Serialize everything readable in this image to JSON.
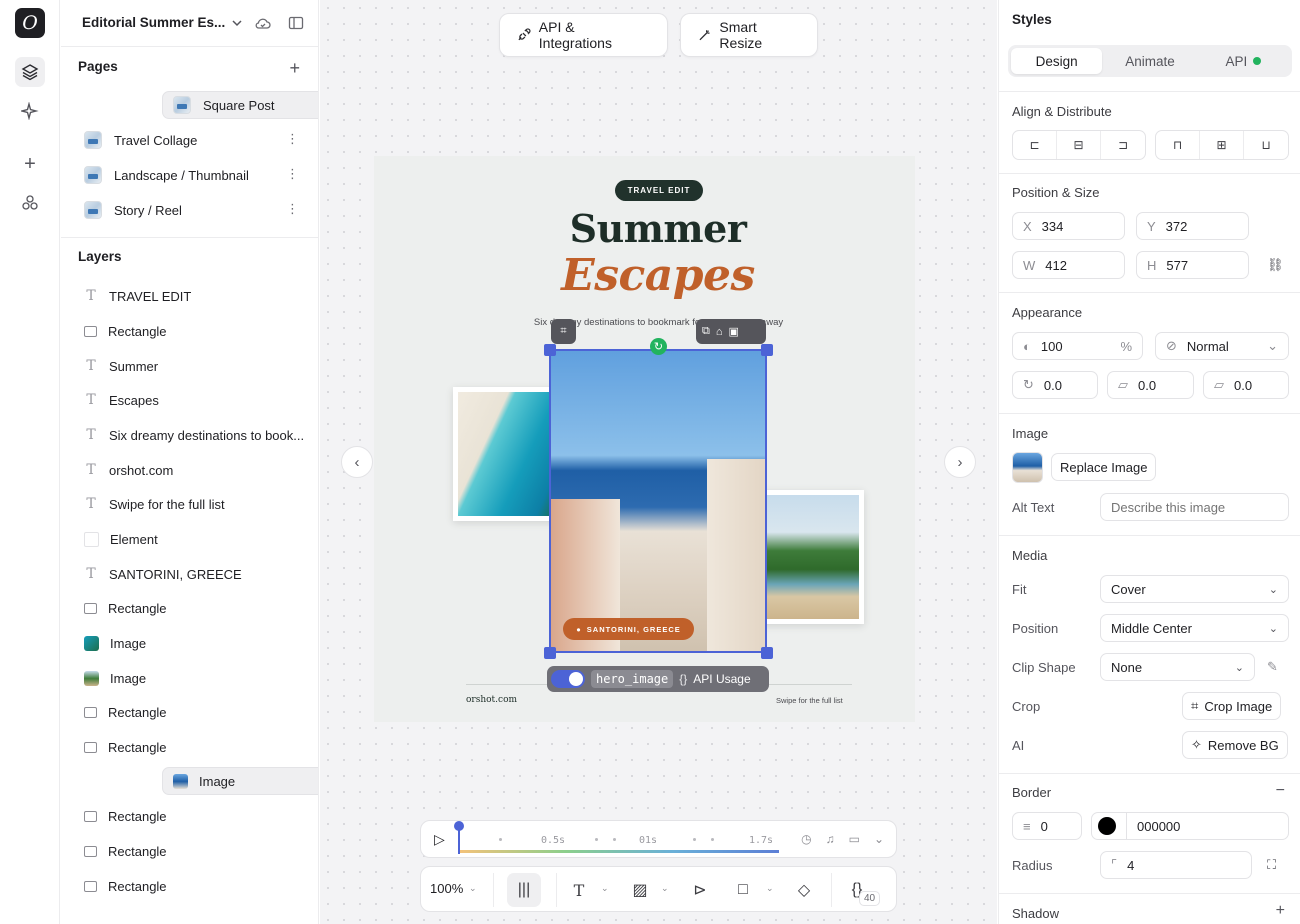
{
  "project": {
    "name": "Editorial Summer Es...",
    "sections": {
      "pages": "Pages",
      "layers": "Layers"
    }
  },
  "pages": [
    {
      "label": "Square Post",
      "selected": true
    },
    {
      "label": "Travel Collage",
      "selected": false
    },
    {
      "label": "Landscape / Thumbnail",
      "selected": false
    },
    {
      "label": "Story / Reel",
      "selected": false
    }
  ],
  "layers": [
    {
      "label": "TRAVEL EDIT",
      "type": "text"
    },
    {
      "label": "Rectangle",
      "type": "rect"
    },
    {
      "label": "Summer",
      "type": "text"
    },
    {
      "label": "Escapes",
      "type": "text"
    },
    {
      "label": "Six dreamy destinations to book...",
      "type": "text"
    },
    {
      "label": "orshot.com",
      "type": "text"
    },
    {
      "label": "Swipe for the full list",
      "type": "text"
    },
    {
      "label": "Element",
      "type": "element"
    },
    {
      "label": "SANTORINI, GREECE",
      "type": "text"
    },
    {
      "label": "Rectangle",
      "type": "rect"
    },
    {
      "label": "Image",
      "type": "image"
    },
    {
      "label": "Image",
      "type": "image"
    },
    {
      "label": "Rectangle",
      "type": "rect"
    },
    {
      "label": "Rectangle",
      "type": "rect"
    },
    {
      "label": "Image",
      "type": "image",
      "selected": true
    },
    {
      "label": "Rectangle",
      "type": "rect"
    },
    {
      "label": "Rectangle",
      "type": "rect"
    },
    {
      "label": "Rectangle",
      "type": "rect"
    }
  ],
  "toolbar": {
    "api": "API & Integrations",
    "resize": "Smart Resize"
  },
  "design": {
    "badge": "TRAVEL EDIT",
    "title1": "Summer",
    "title2": "Escapes",
    "subtitle": "Six dreamy destinations to bookmark for your next getaway",
    "location": "SANTORINI, GREECE",
    "footer_left": "orshot.com",
    "footer_right": "Swipe for the full list"
  },
  "selection": {
    "layer_name": "hero_image",
    "api_usage": "API Usage"
  },
  "timeline": {
    "marks": [
      "0.5s",
      "01s",
      "1.7s"
    ]
  },
  "bottom": {
    "zoom": "100%",
    "count": "40"
  },
  "styles": {
    "title": "Styles",
    "tabs": [
      "Design",
      "Animate",
      "API"
    ],
    "align_title": "Align & Distribute",
    "pos_title": "Position & Size",
    "x": "334",
    "y": "372",
    "w": "412",
    "h": "577",
    "appearance_title": "Appearance",
    "opacity": "100",
    "opacity_unit": "%",
    "blend": "Normal",
    "rotation": "0.0",
    "skew_x": "0.0",
    "skew_y": "0.0",
    "image_title": "Image",
    "replace": "Replace Image",
    "alt_label": "Alt Text",
    "alt_placeholder": "Describe this image",
    "media_title": "Media",
    "fit_label": "Fit",
    "fit": "Cover",
    "position_label": "Position",
    "position": "Middle Center",
    "clip_label": "Clip Shape",
    "clip": "None",
    "crop_label": "Crop",
    "crop_btn": "Crop Image",
    "ai_label": "AI",
    "ai_btn": "Remove BG",
    "border_title": "Border",
    "border_width": "0",
    "border_color": "000000",
    "radius_label": "Radius",
    "radius": "4",
    "shadow_title": "Shadow"
  },
  "colors": {
    "accent": "#4c63d6",
    "brand_orange": "#c0602a",
    "dark_green": "#21322c",
    "live": "#22b35e"
  }
}
